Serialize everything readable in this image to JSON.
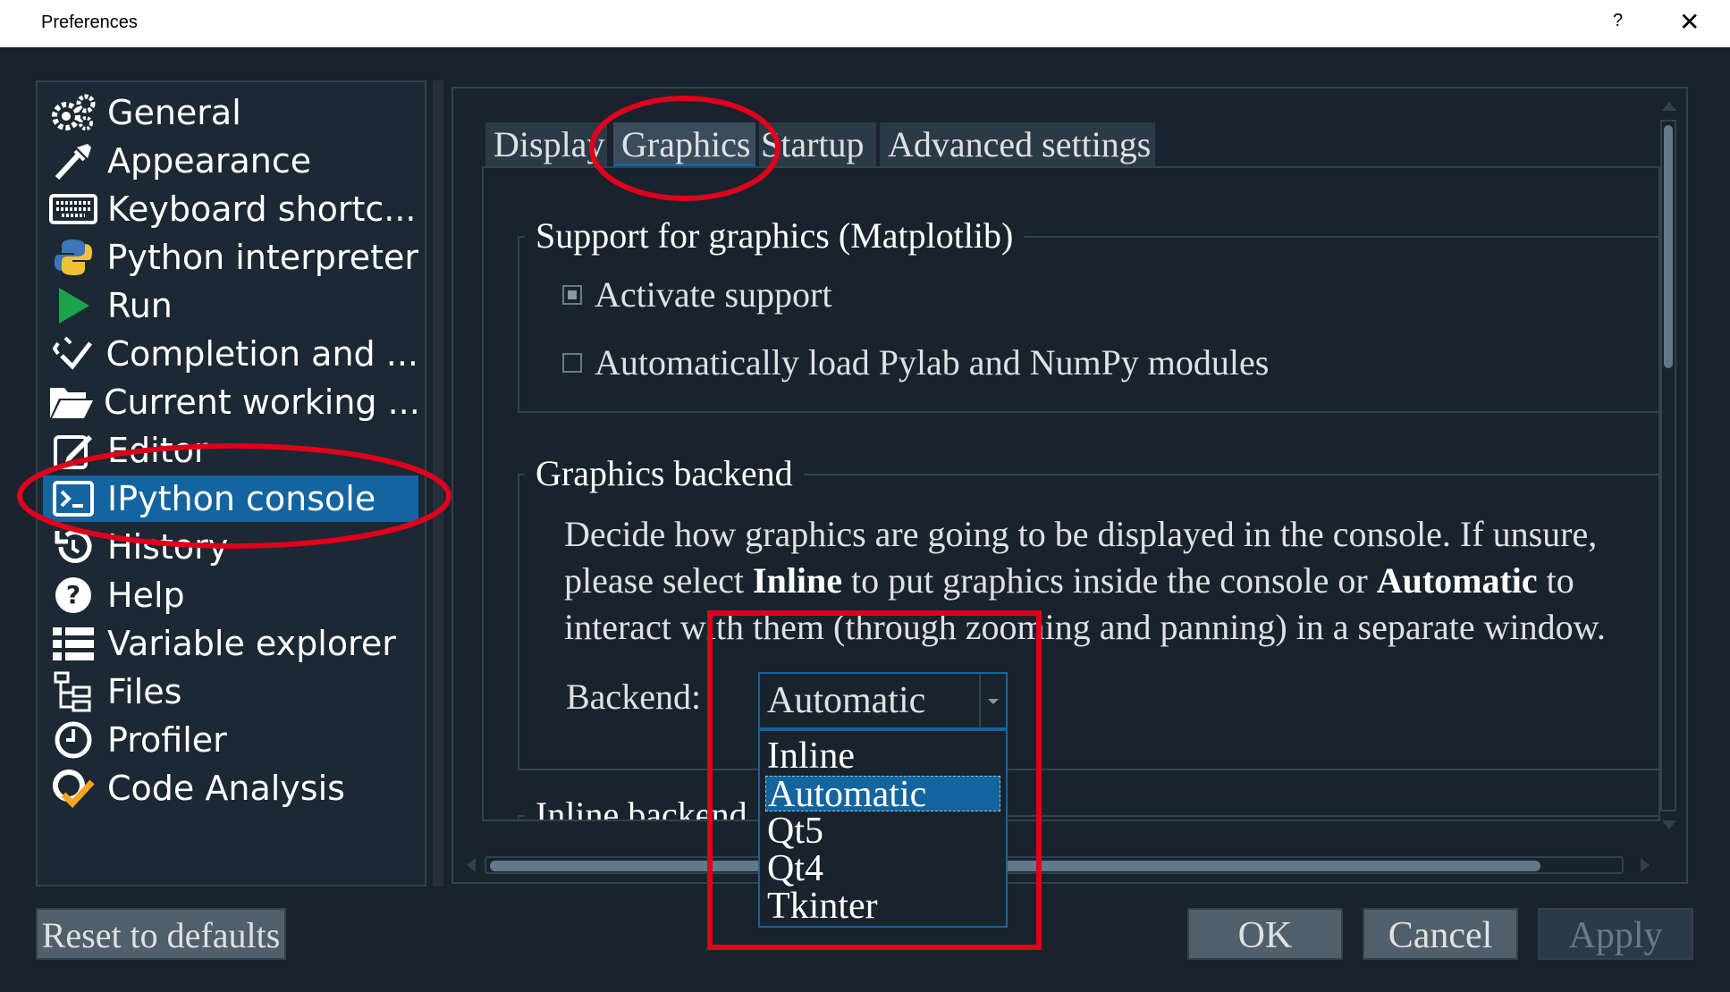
{
  "window": {
    "title": "Preferences",
    "help": "?",
    "close": "✕"
  },
  "sidebar": {
    "items": [
      {
        "label": "General",
        "icon": "gears-icon"
      },
      {
        "label": "Appearance",
        "icon": "eyedropper-icon"
      },
      {
        "label": "Keyboard shortc...",
        "icon": "keyboard-icon"
      },
      {
        "label": "Python interpreter",
        "icon": "python-icon"
      },
      {
        "label": "Run",
        "icon": "play-icon"
      },
      {
        "label": "Completion and ...",
        "icon": "completion-icon"
      },
      {
        "label": "Current working ...",
        "icon": "folder-open-icon"
      },
      {
        "label": "Editor",
        "icon": "edit-icon"
      },
      {
        "label": "IPython console",
        "icon": "terminal-icon",
        "selected": true
      },
      {
        "label": "History",
        "icon": "history-icon"
      },
      {
        "label": "Help",
        "icon": "help-circle-icon"
      },
      {
        "label": "Variable explorer",
        "icon": "list-icon"
      },
      {
        "label": "Files",
        "icon": "files-tree-icon"
      },
      {
        "label": "Profiler",
        "icon": "clock-icon"
      },
      {
        "label": "Code Analysis",
        "icon": "code-analysis-icon"
      }
    ]
  },
  "tabs": [
    {
      "label": "Display"
    },
    {
      "label": "Graphics",
      "active": true
    },
    {
      "label": "Startup"
    },
    {
      "label": "Advanced settings"
    }
  ],
  "support_group": {
    "title": "Support for graphics (Matplotlib)",
    "activate_label": "Activate support",
    "activate_checked": true,
    "pylab_label": "Automatically load Pylab and NumPy modules",
    "pylab_checked": false
  },
  "backend_group": {
    "title": "Graphics backend",
    "desc_line1": "Decide how graphics are going to be displayed in the console. If unsure,",
    "desc_line2_a": "please select ",
    "desc_line2_b": "Inline",
    "desc_line2_c": " to put graphics inside the console or ",
    "desc_line2_d": "Automatic",
    "desc_line2_e": " to",
    "desc_line3": "interact with them (through zooming and panning) in a separate window.",
    "backend_label": "Backend:",
    "backend_value": "Automatic",
    "options": [
      "Inline",
      "Automatic",
      "Qt5",
      "Qt4",
      "Tkinter"
    ],
    "selected_option": "Automatic"
  },
  "inline_group": {
    "title": "Inline backend"
  },
  "buttons": {
    "reset": "Reset to defaults",
    "ok": "OK",
    "cancel": "Cancel",
    "apply": "Apply"
  },
  "colors": {
    "background": "#19232d",
    "accent": "#1464a0",
    "annotation": "#e0001b"
  }
}
